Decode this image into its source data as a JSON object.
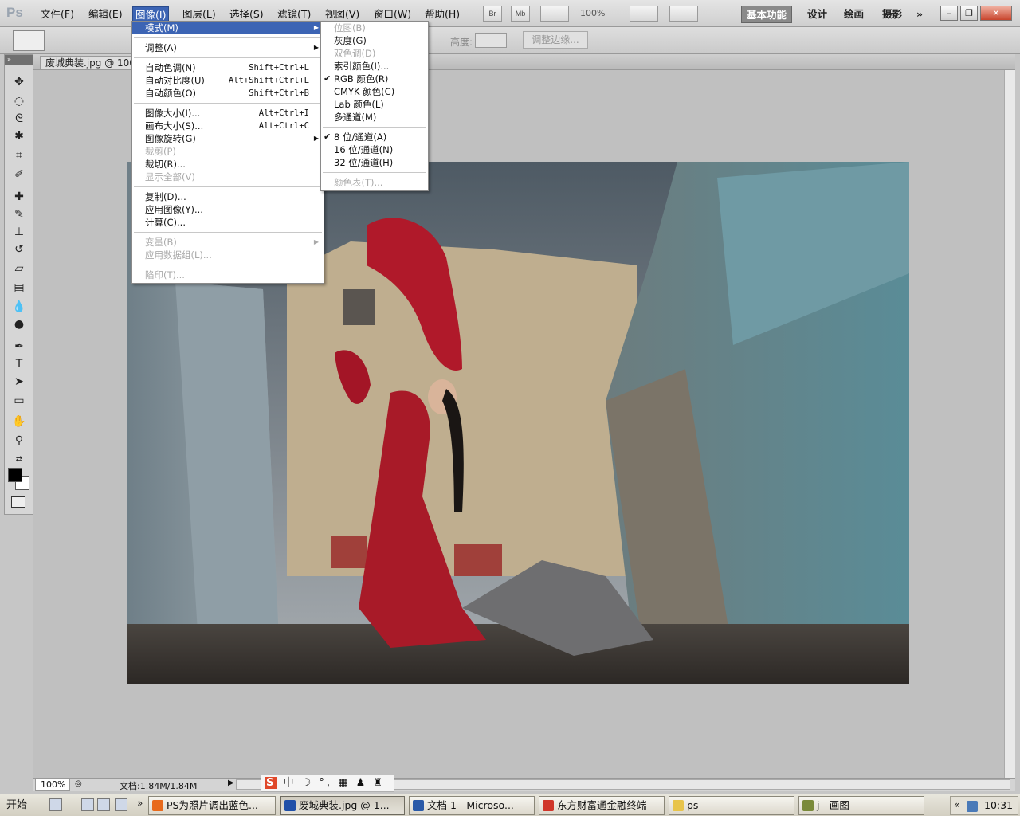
{
  "app": {
    "logo": "Ps"
  },
  "menubar": {
    "items": [
      "文件(F)",
      "编辑(E)",
      "图像(I)",
      "图层(L)",
      "选择(S)",
      "滤镜(T)",
      "视图(V)",
      "窗口(W)",
      "帮助(H)"
    ],
    "bridge_label": "Br",
    "minibridge_label": "Mb",
    "zoom_label": "100%",
    "workspaces": [
      "基本功能",
      "设计",
      "绘画",
      "摄影"
    ],
    "workspace_more": "»"
  },
  "options": {
    "height_label": "高度:",
    "refine_edge": "调整边缘..."
  },
  "document": {
    "tab_title": "废城典装.jpg @ 100%"
  },
  "image_menu": {
    "mode": "模式(M)",
    "adjust": "调整(A)",
    "auto_tone": "自动色调(N)",
    "auto_tone_sc": "Shift+Ctrl+L",
    "auto_contrast": "自动对比度(U)",
    "auto_contrast_sc": "Alt+Shift+Ctrl+L",
    "auto_color": "自动颜色(O)",
    "auto_color_sc": "Shift+Ctrl+B",
    "image_size": "图像大小(I)...",
    "image_size_sc": "Alt+Ctrl+I",
    "canvas_size": "画布大小(S)...",
    "canvas_size_sc": "Alt+Ctrl+C",
    "rotate": "图像旋转(G)",
    "crop": "裁剪(P)",
    "trim": "裁切(R)...",
    "reveal_all": "显示全部(V)",
    "duplicate": "复制(D)...",
    "apply_image": "应用图像(Y)...",
    "calculations": "计算(C)...",
    "variables": "变量(B)",
    "apply_data_set": "应用数据组(L)...",
    "trap": "陷印(T)..."
  },
  "mode_menu": {
    "bitmap": "位图(B)",
    "grayscale": "灰度(G)",
    "duotone": "双色调(D)",
    "indexed": "索引颜色(I)...",
    "rgb": "RGB 颜色(R)",
    "cmyk": "CMYK 颜色(C)",
    "lab": "Lab 颜色(L)",
    "multichannel": "多通道(M)",
    "bit8": "8 位/通道(A)",
    "bit16": "16 位/通道(N)",
    "bit32": "32 位/通道(H)",
    "color_table": "颜色表(T)...",
    "check": "✔"
  },
  "statusbar": {
    "zoom": "100%",
    "doc_info": "文档:1.84M/1.84M"
  },
  "ime": {
    "logo": "S",
    "text": "中 ☽ °, ▦ ♟ ♜ ✎"
  },
  "taskbar": {
    "start": "开始",
    "more": "»",
    "tasks": [
      "PS为照片调出蓝色...",
      "废城典装.jpg @ 1...",
      "文档 1 - Microso...",
      "东方财富通金融终端",
      "ps",
      "j - 画图"
    ],
    "tray_more": "«",
    "clock": "10:31"
  },
  "colors": {
    "menu_highlight": "#3c64b4",
    "accent_task": "#1f4fa8"
  }
}
